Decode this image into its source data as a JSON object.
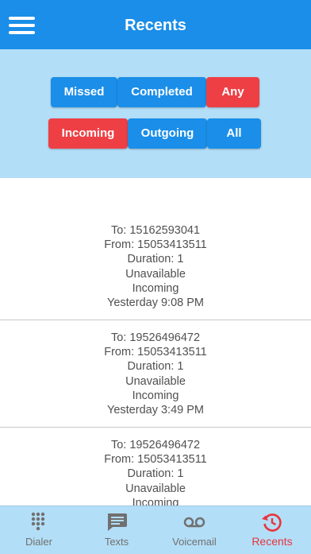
{
  "header": {
    "title": "Recents",
    "menu_icon": "hamburger-menu-icon"
  },
  "filters": {
    "row1": [
      {
        "label": "Missed",
        "active": false
      },
      {
        "label": "Completed",
        "active": false
      },
      {
        "label": "Any",
        "active": true
      }
    ],
    "row2": [
      {
        "label": "Incoming",
        "active": true
      },
      {
        "label": "Outgoing",
        "active": false
      },
      {
        "label": "All",
        "active": false
      }
    ]
  },
  "calls": [
    {
      "to": "To: 15162593041",
      "from": "From: 15053413511",
      "duration": "Duration: 1",
      "status": "Unavailable",
      "direction": "Incoming",
      "time": "Yesterday 9:08 PM"
    },
    {
      "to": "To: 19526496472",
      "from": "From: 15053413511",
      "duration": "Duration: 1",
      "status": "Unavailable",
      "direction": "Incoming",
      "time": "Yesterday 3:49 PM"
    },
    {
      "to": "To: 19526496472",
      "from": "From: 15053413511",
      "duration": "Duration: 1",
      "status": "Unavailable",
      "direction": "Incoming",
      "time": ""
    }
  ],
  "tabs": [
    {
      "label": "Dialer",
      "icon": "dialpad-icon",
      "active": false
    },
    {
      "label": "Texts",
      "icon": "message-icon",
      "active": false
    },
    {
      "label": "Voicemail",
      "icon": "voicemail-icon",
      "active": false
    },
    {
      "label": "Recents",
      "icon": "history-icon",
      "active": true
    }
  ],
  "colors": {
    "primary": "#1a8ee8",
    "accent": "#ee3f45",
    "panel": "#b3def7",
    "tab_active": "#e9343c",
    "tab_inactive": "#707070"
  }
}
